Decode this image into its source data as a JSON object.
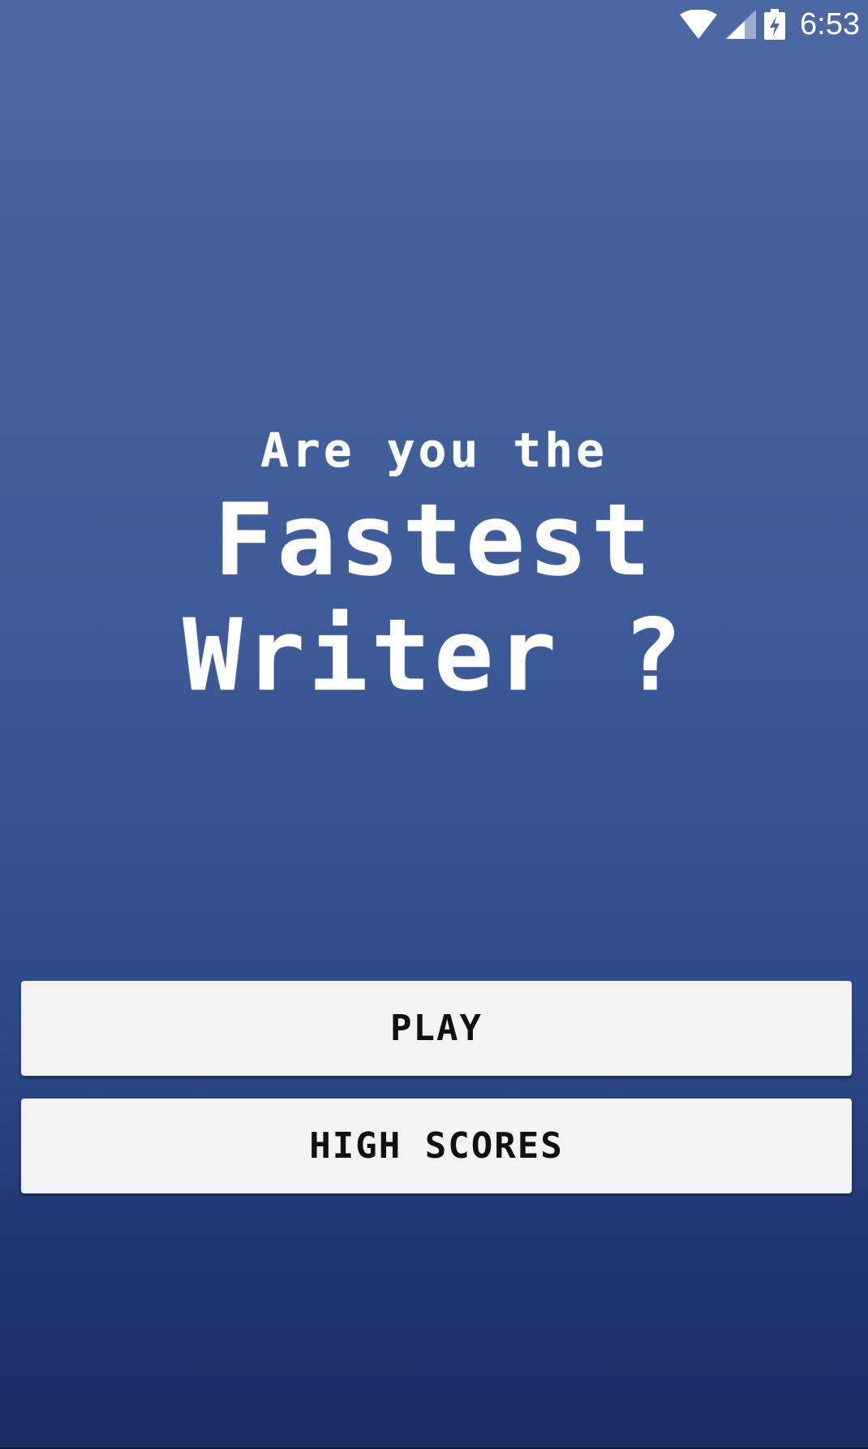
{
  "status_bar": {
    "time": "6:53",
    "icons": [
      "wifi-icon",
      "cell-signal-icon",
      "battery-charging-icon"
    ],
    "icon_color": "#ffffff"
  },
  "headline": {
    "line1": "Are you the",
    "line2": "Fastest",
    "line3": "Writer ?"
  },
  "menu": {
    "play_label": "PLAY",
    "high_scores_label": "HIGH SCORES"
  },
  "colors": {
    "background_top": "#4c68a2",
    "background_bottom": "#1b2c66",
    "button_bg": "#f3f3f3",
    "button_text": "#111111",
    "headline_text": "#ffffff"
  }
}
